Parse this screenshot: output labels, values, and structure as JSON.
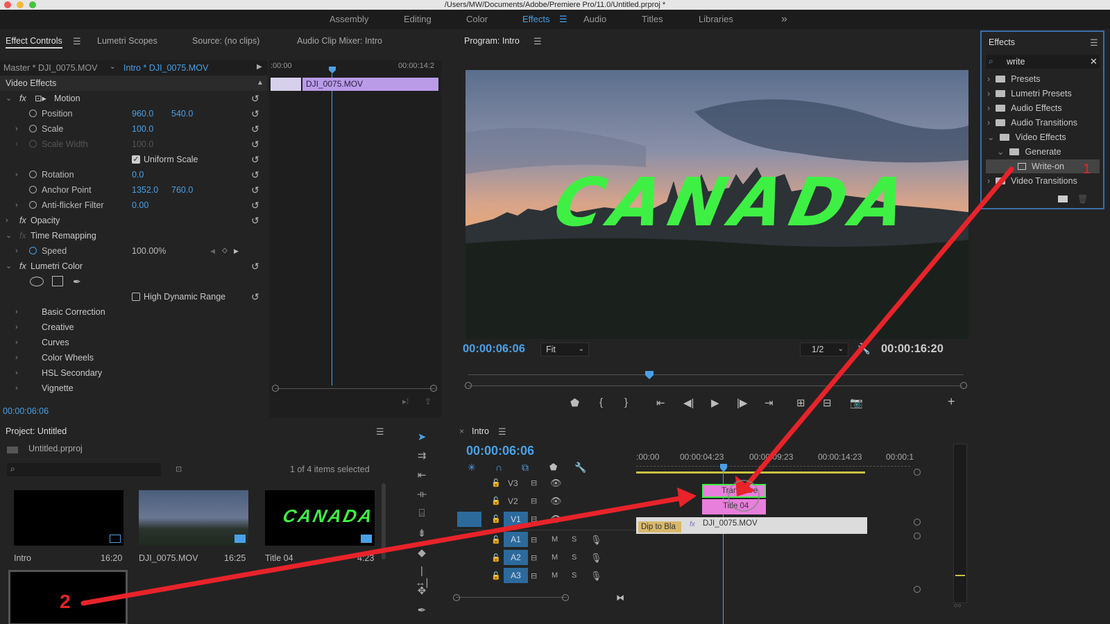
{
  "window": {
    "title": "/Users/MW/Documents/Adobe/Premiere Pro/11.0/Untitled.prproj *"
  },
  "workspaces": [
    "Assembly",
    "Editing",
    "Color",
    "Effects",
    "Audio",
    "Titles",
    "Libraries"
  ],
  "workspaces_overflow": "»",
  "effect_controls": {
    "tabs": [
      "Effect Controls",
      "Lumetri Scopes",
      "Source: (no clips)",
      "Audio Clip Mixer: Intro"
    ],
    "master_label": "Master * DJI_0075.MOV",
    "sequence_label": "Intro * DJI_0075.MOV",
    "ruler_start": ":00:00",
    "ruler_end": "00:00:14:2",
    "clip_label": "DJI_0075.MOV",
    "section": "Video Effects",
    "motion": "Motion",
    "position_label": "Position",
    "position_x": "960.0",
    "position_y": "540.0",
    "scale_label": "Scale",
    "scale": "100.0",
    "scale_width_label": "Scale Width",
    "scale_width": "100.0",
    "uniform_scale": "Uniform Scale",
    "rotation_label": "Rotation",
    "rotation": "0.0",
    "anchor_label": "Anchor Point",
    "anchor_x": "1352.0",
    "anchor_y": "760.0",
    "antiflicker_label": "Anti-flicker Filter",
    "antiflicker": "0.00",
    "opacity": "Opacity",
    "time_remapping": "Time Remapping",
    "speed_label": "Speed",
    "speed": "100.00%",
    "lumetri": "Lumetri Color",
    "hdr": "High Dynamic Range",
    "lumetri_items": [
      "Basic Correction",
      "Creative",
      "Curves",
      "Color Wheels",
      "HSL Secondary",
      "Vignette"
    ],
    "timecode": "00:00:06:06"
  },
  "program": {
    "title": "Program: Intro",
    "overlay_text": "CANADA",
    "timecode": "00:00:06:06",
    "fit": "Fit",
    "resolution": "1/2",
    "duration": "00:00:16:20"
  },
  "effects_panel": {
    "title": "Effects",
    "search_value": "write",
    "tree": [
      {
        "label": "Presets",
        "level": 0,
        "kind": "bin"
      },
      {
        "label": "Lumetri Presets",
        "level": 0,
        "kind": "bin"
      },
      {
        "label": "Audio Effects",
        "level": 0,
        "kind": "folder"
      },
      {
        "label": "Audio Transitions",
        "level": 0,
        "kind": "folder"
      },
      {
        "label": "Video Effects",
        "level": 0,
        "kind": "folder",
        "open": true
      },
      {
        "label": "Generate",
        "level": 1,
        "kind": "folder",
        "open": true
      },
      {
        "label": "Write-on",
        "level": 2,
        "kind": "effect",
        "selected": true
      },
      {
        "label": "Video Transitions",
        "level": 0,
        "kind": "folder"
      }
    ]
  },
  "project": {
    "title": "Project: Untitled",
    "file": "Untitled.prproj",
    "selection": "1 of 4 items selected",
    "items": [
      {
        "name": "Intro",
        "duration": "16:20"
      },
      {
        "name": "DJI_0075.MOV",
        "duration": "16:25"
      },
      {
        "name": "Title 04",
        "duration": "4:23",
        "thumb_text": "CANADA"
      }
    ]
  },
  "timeline": {
    "title": "Intro",
    "timecode": "00:00:06:06",
    "ruler": [
      ":00:00",
      "00:00:04:23",
      "00:00:09:23",
      "00:00:14:23",
      "00:00:1"
    ],
    "tracks": [
      "V3",
      "V2",
      "V1",
      "A1",
      "A2",
      "A3"
    ],
    "clip_v3": "Transpare",
    "clip_v2": "Title 04",
    "clip_v1": "DJI_0075.MOV",
    "transition_v1": "Dip to Bla",
    "mute": "M",
    "solo": "S"
  },
  "annotations": {
    "one": "1",
    "two": "2"
  },
  "colors": {
    "accent": "#4aa0e6",
    "arrow": "#e8232a",
    "canada_text": "#3ef044",
    "title_clip": "#e87fdc",
    "clip_label": "#b99be8"
  }
}
